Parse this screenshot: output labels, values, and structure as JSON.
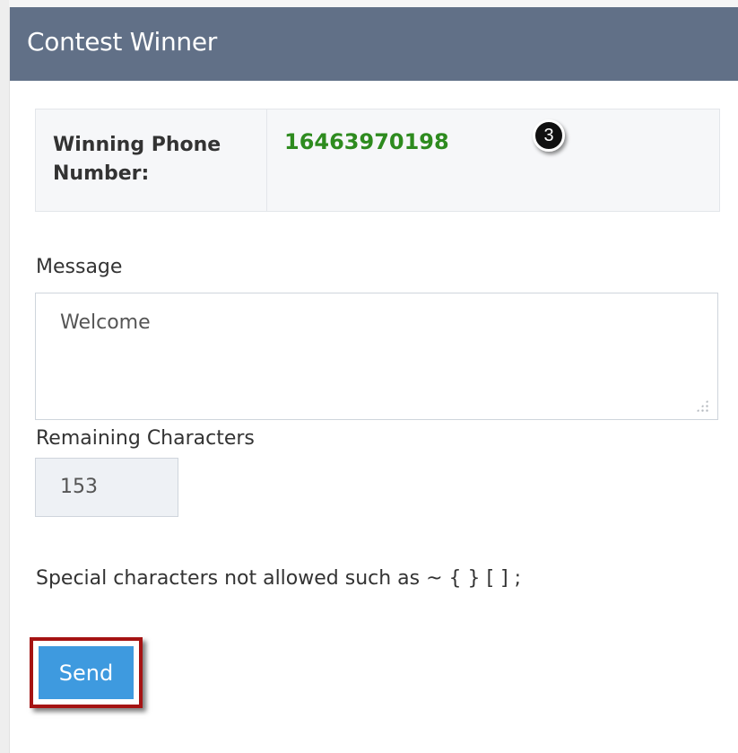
{
  "panel": {
    "title": "Contest Winner"
  },
  "winner": {
    "label": "Winning Phone Number:",
    "phone_number": "16463970198"
  },
  "step_badge": "3",
  "message": {
    "label": "Message",
    "value": "Welcome"
  },
  "remaining": {
    "label": "Remaining Characters",
    "value": "153"
  },
  "note": "Special characters not allowed such as ~ { } [ ] ;",
  "send_button": {
    "label": "Send"
  },
  "colors": {
    "header": "#617087",
    "phone_number": "#2e8b1f",
    "send_button": "#3e9adf",
    "highlight_outline": "#a51313"
  },
  "icons": {
    "resize": "resize-grip-icon"
  }
}
